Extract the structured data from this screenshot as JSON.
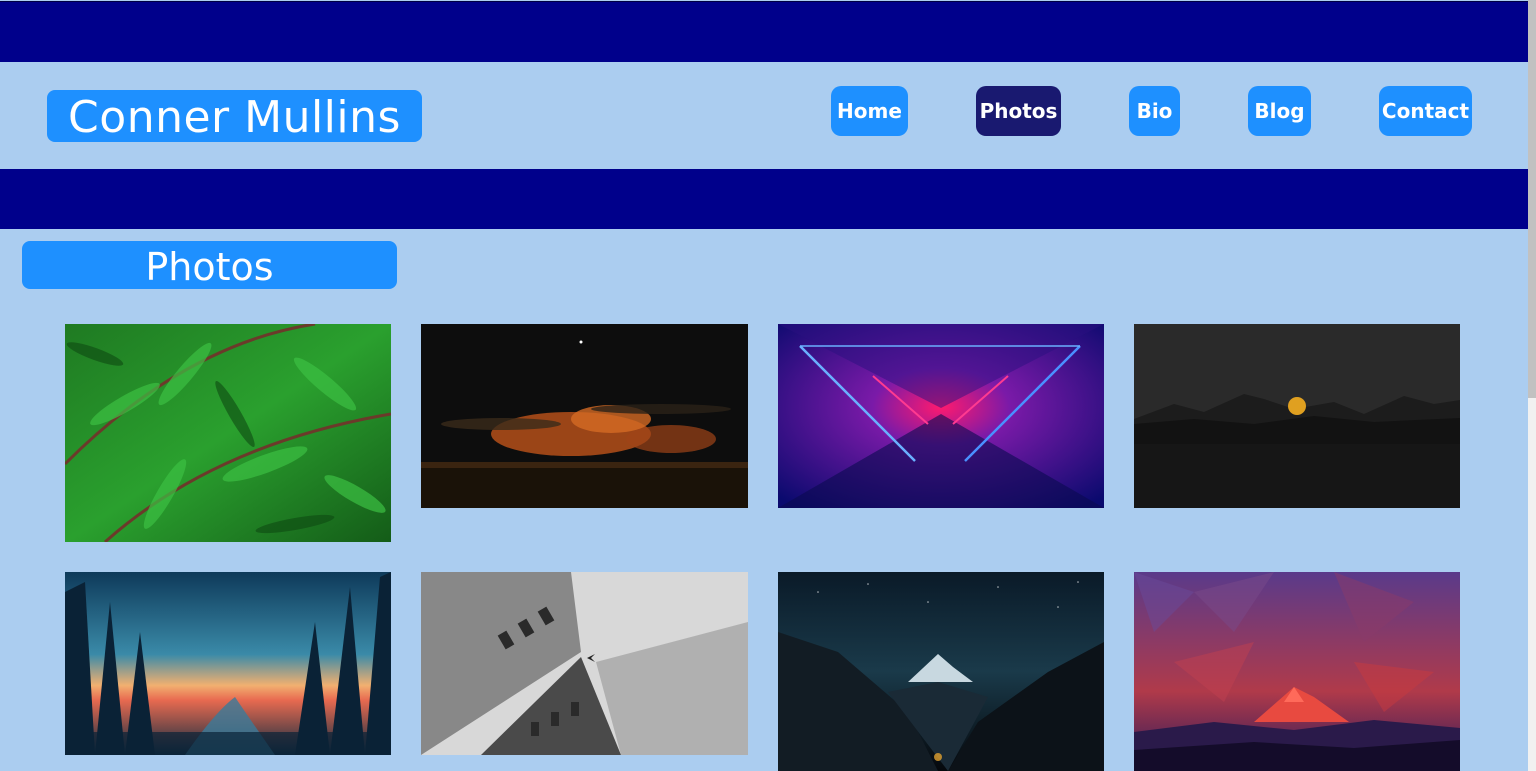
{
  "site": {
    "title": "Conner Mullins"
  },
  "nav": {
    "items": [
      {
        "label": "Home",
        "active": false
      },
      {
        "label": "Photos",
        "active": true
      },
      {
        "label": "Bio",
        "active": false
      },
      {
        "label": "Blog",
        "active": false
      },
      {
        "label": "Contact",
        "active": false
      }
    ]
  },
  "main": {
    "heading": "Photos",
    "photos": [
      {
        "subject": "green fern leaves with water droplets"
      },
      {
        "subject": "orange clouds over dark sea at night"
      },
      {
        "subject": "neon pink and blue light tunnel"
      },
      {
        "subject": "dark silhouette landscape with yellow moon"
      },
      {
        "subject": "forest river at sunset illustration"
      },
      {
        "subject": "grayscale skyscrapers with airplane overhead"
      },
      {
        "subject": "mountain peak under starry night sky"
      },
      {
        "subject": "low poly red mountain landscape"
      }
    ]
  },
  "colors": {
    "background": "#abcdf0",
    "stripe": "#00008b",
    "button": "#1e90ff",
    "button_active": "#191970",
    "text": "#ffffff"
  }
}
